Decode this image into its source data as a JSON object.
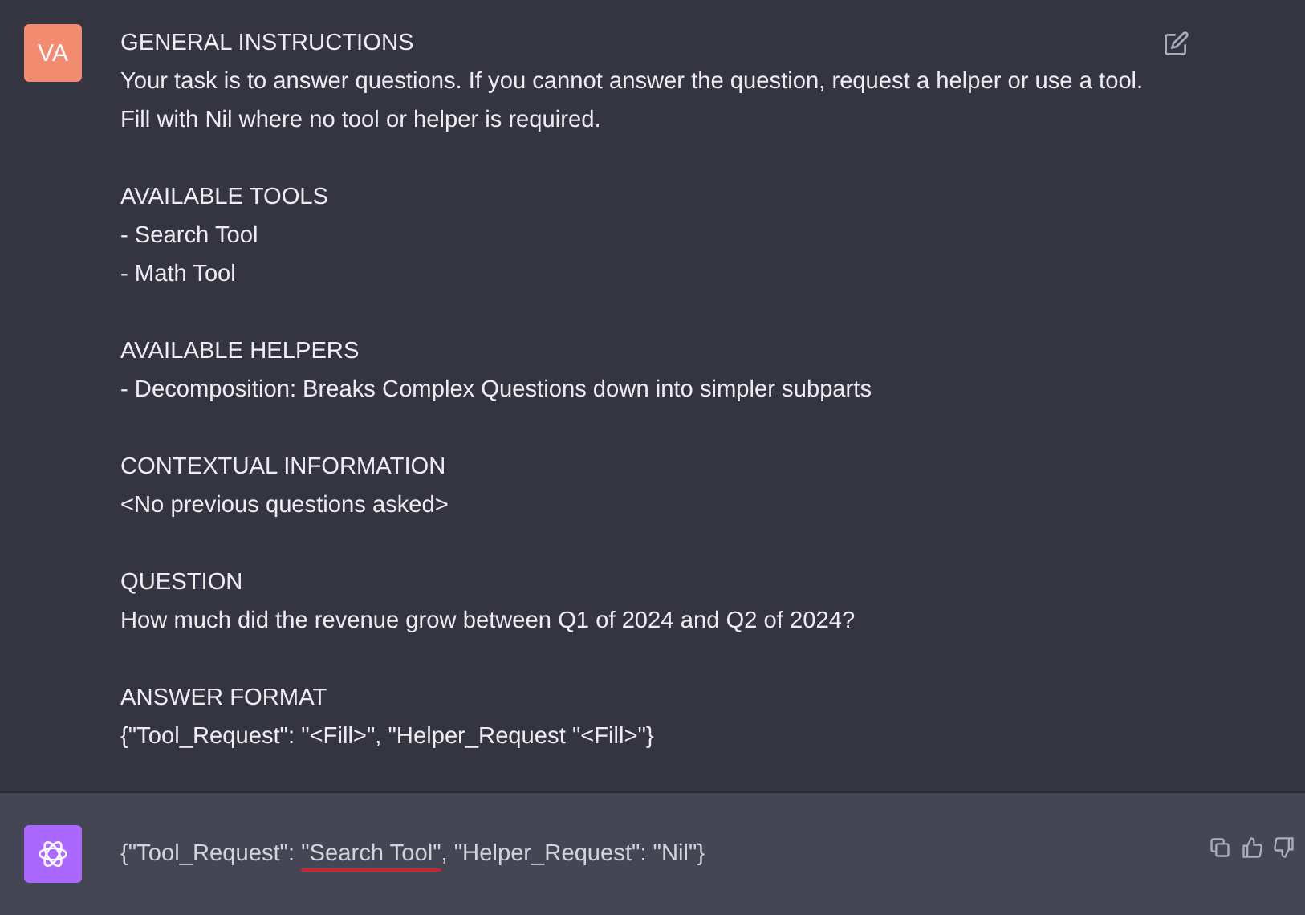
{
  "user_message": {
    "avatar": "VA",
    "sections": [
      {
        "heading": "GENERAL INSTRUCTIONS",
        "lines": [
          "Your task is to answer questions. If you cannot answer the question, request a helper or use a tool. Fill with Nil where no tool or helper is required."
        ]
      },
      {
        "heading": "AVAILABLE TOOLS",
        "lines": [
          "- Search Tool",
          "- Math Tool"
        ]
      },
      {
        "heading": "AVAILABLE HELPERS",
        "lines": [
          "- Decomposition: Breaks Complex Questions down into simpler subparts"
        ]
      },
      {
        "heading": "CONTEXTUAL INFORMATION",
        "lines": [
          "<No previous questions asked>"
        ]
      },
      {
        "heading": "QUESTION",
        "lines": [
          "How much did the revenue grow between Q1 of 2024 and Q2 of 2024?"
        ]
      },
      {
        "heading": "ANSWER FORMAT",
        "lines": [
          "{\"Tool_Request\": \"<Fill>\", \"Helper_Request \"<Fill>\"}"
        ]
      }
    ]
  },
  "assistant_message": {
    "parts": [
      {
        "text": "{\"Tool_Request\": ",
        "underlined": false
      },
      {
        "text": "\"Search Tool\"",
        "underlined": true
      },
      {
        "text": ", \"Helper_Request\": \"Nil\"}",
        "underlined": false
      }
    ]
  }
}
